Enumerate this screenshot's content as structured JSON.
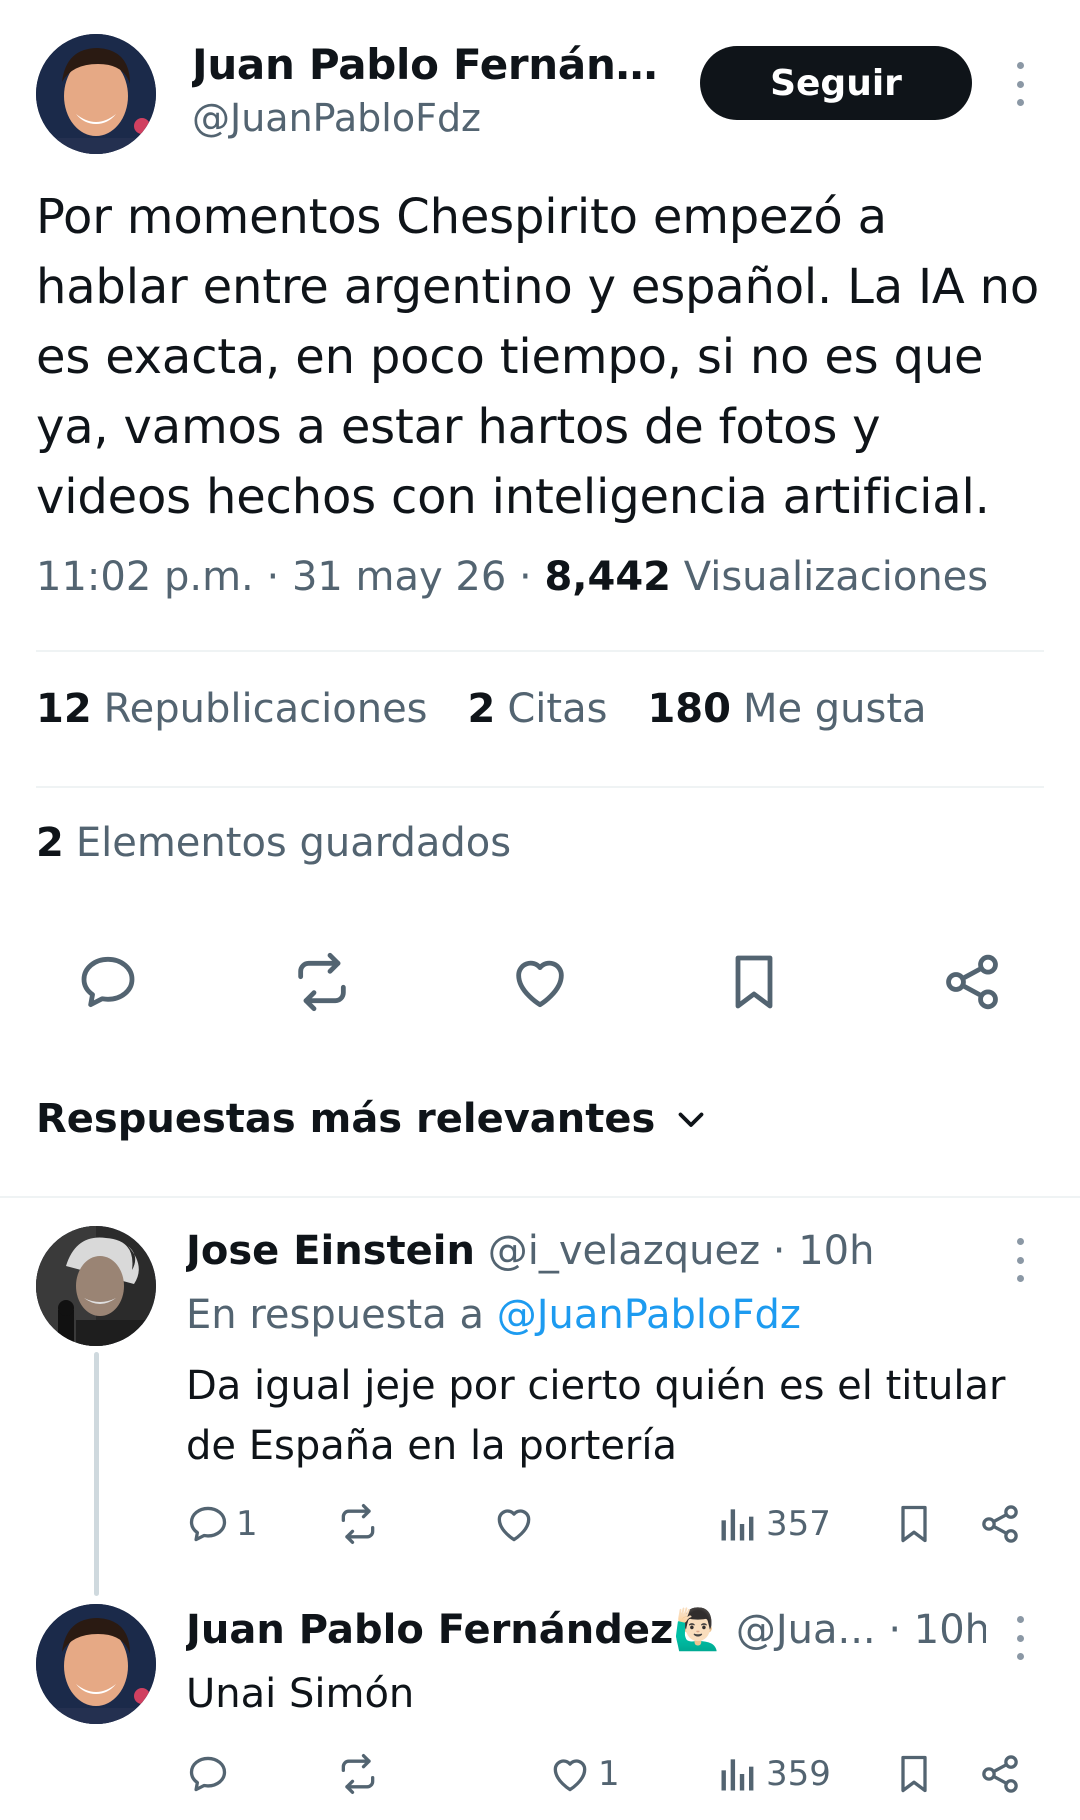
{
  "tweet": {
    "author_name": "Juan Pablo Fernánd...",
    "author_handle": "@JuanPabloFdz",
    "follow_label": "Seguir",
    "text": "Por momentos Chespirito empezó a hablar entre argentino y español. La IA no es exacta, en poco tiempo, si no es que ya, vamos a estar hartos de fotos y videos hechos con inteligencia artificial.",
    "time": "11:02 p.m.",
    "date": "31 may 26",
    "views_count": "8,442",
    "views_label": "Visualizaciones",
    "reposts_count": "12",
    "reposts_label": "Republicaciones",
    "quotes_count": "2",
    "quotes_label": "Citas",
    "likes_count": "180",
    "likes_label": "Me gusta",
    "saved_count": "2",
    "saved_label": "Elementos guardados",
    "icons": [
      "reply-icon",
      "repost-icon",
      "like-icon",
      "bookmark-icon",
      "share-icon"
    ]
  },
  "replies_sort": {
    "label": "Respuestas más relevantes"
  },
  "replies": [
    {
      "name": "Jose Einstein",
      "handle": "@i_velazquez",
      "time": "10h",
      "reply_to_prefix": "En respuesta a",
      "reply_to_handle": "@JuanPabloFdz",
      "text": "Da igual jeje por cierto quién es el titular de España en la portería",
      "reply_count": "1",
      "repost_count": "",
      "like_count": "",
      "views": "357"
    },
    {
      "name": "Juan Pablo Fernández🙋🏻‍♂️",
      "handle": "@Jua...",
      "time": "10h",
      "text": "Unai Simón",
      "reply_count": "",
      "repost_count": "",
      "like_count": "1",
      "views": "359"
    }
  ],
  "colors": {
    "text_primary": "#0f1419",
    "text_secondary": "#536471",
    "link": "#1d9bf0",
    "follow_bg": "#0f1419",
    "divider": "#eff3f4"
  }
}
